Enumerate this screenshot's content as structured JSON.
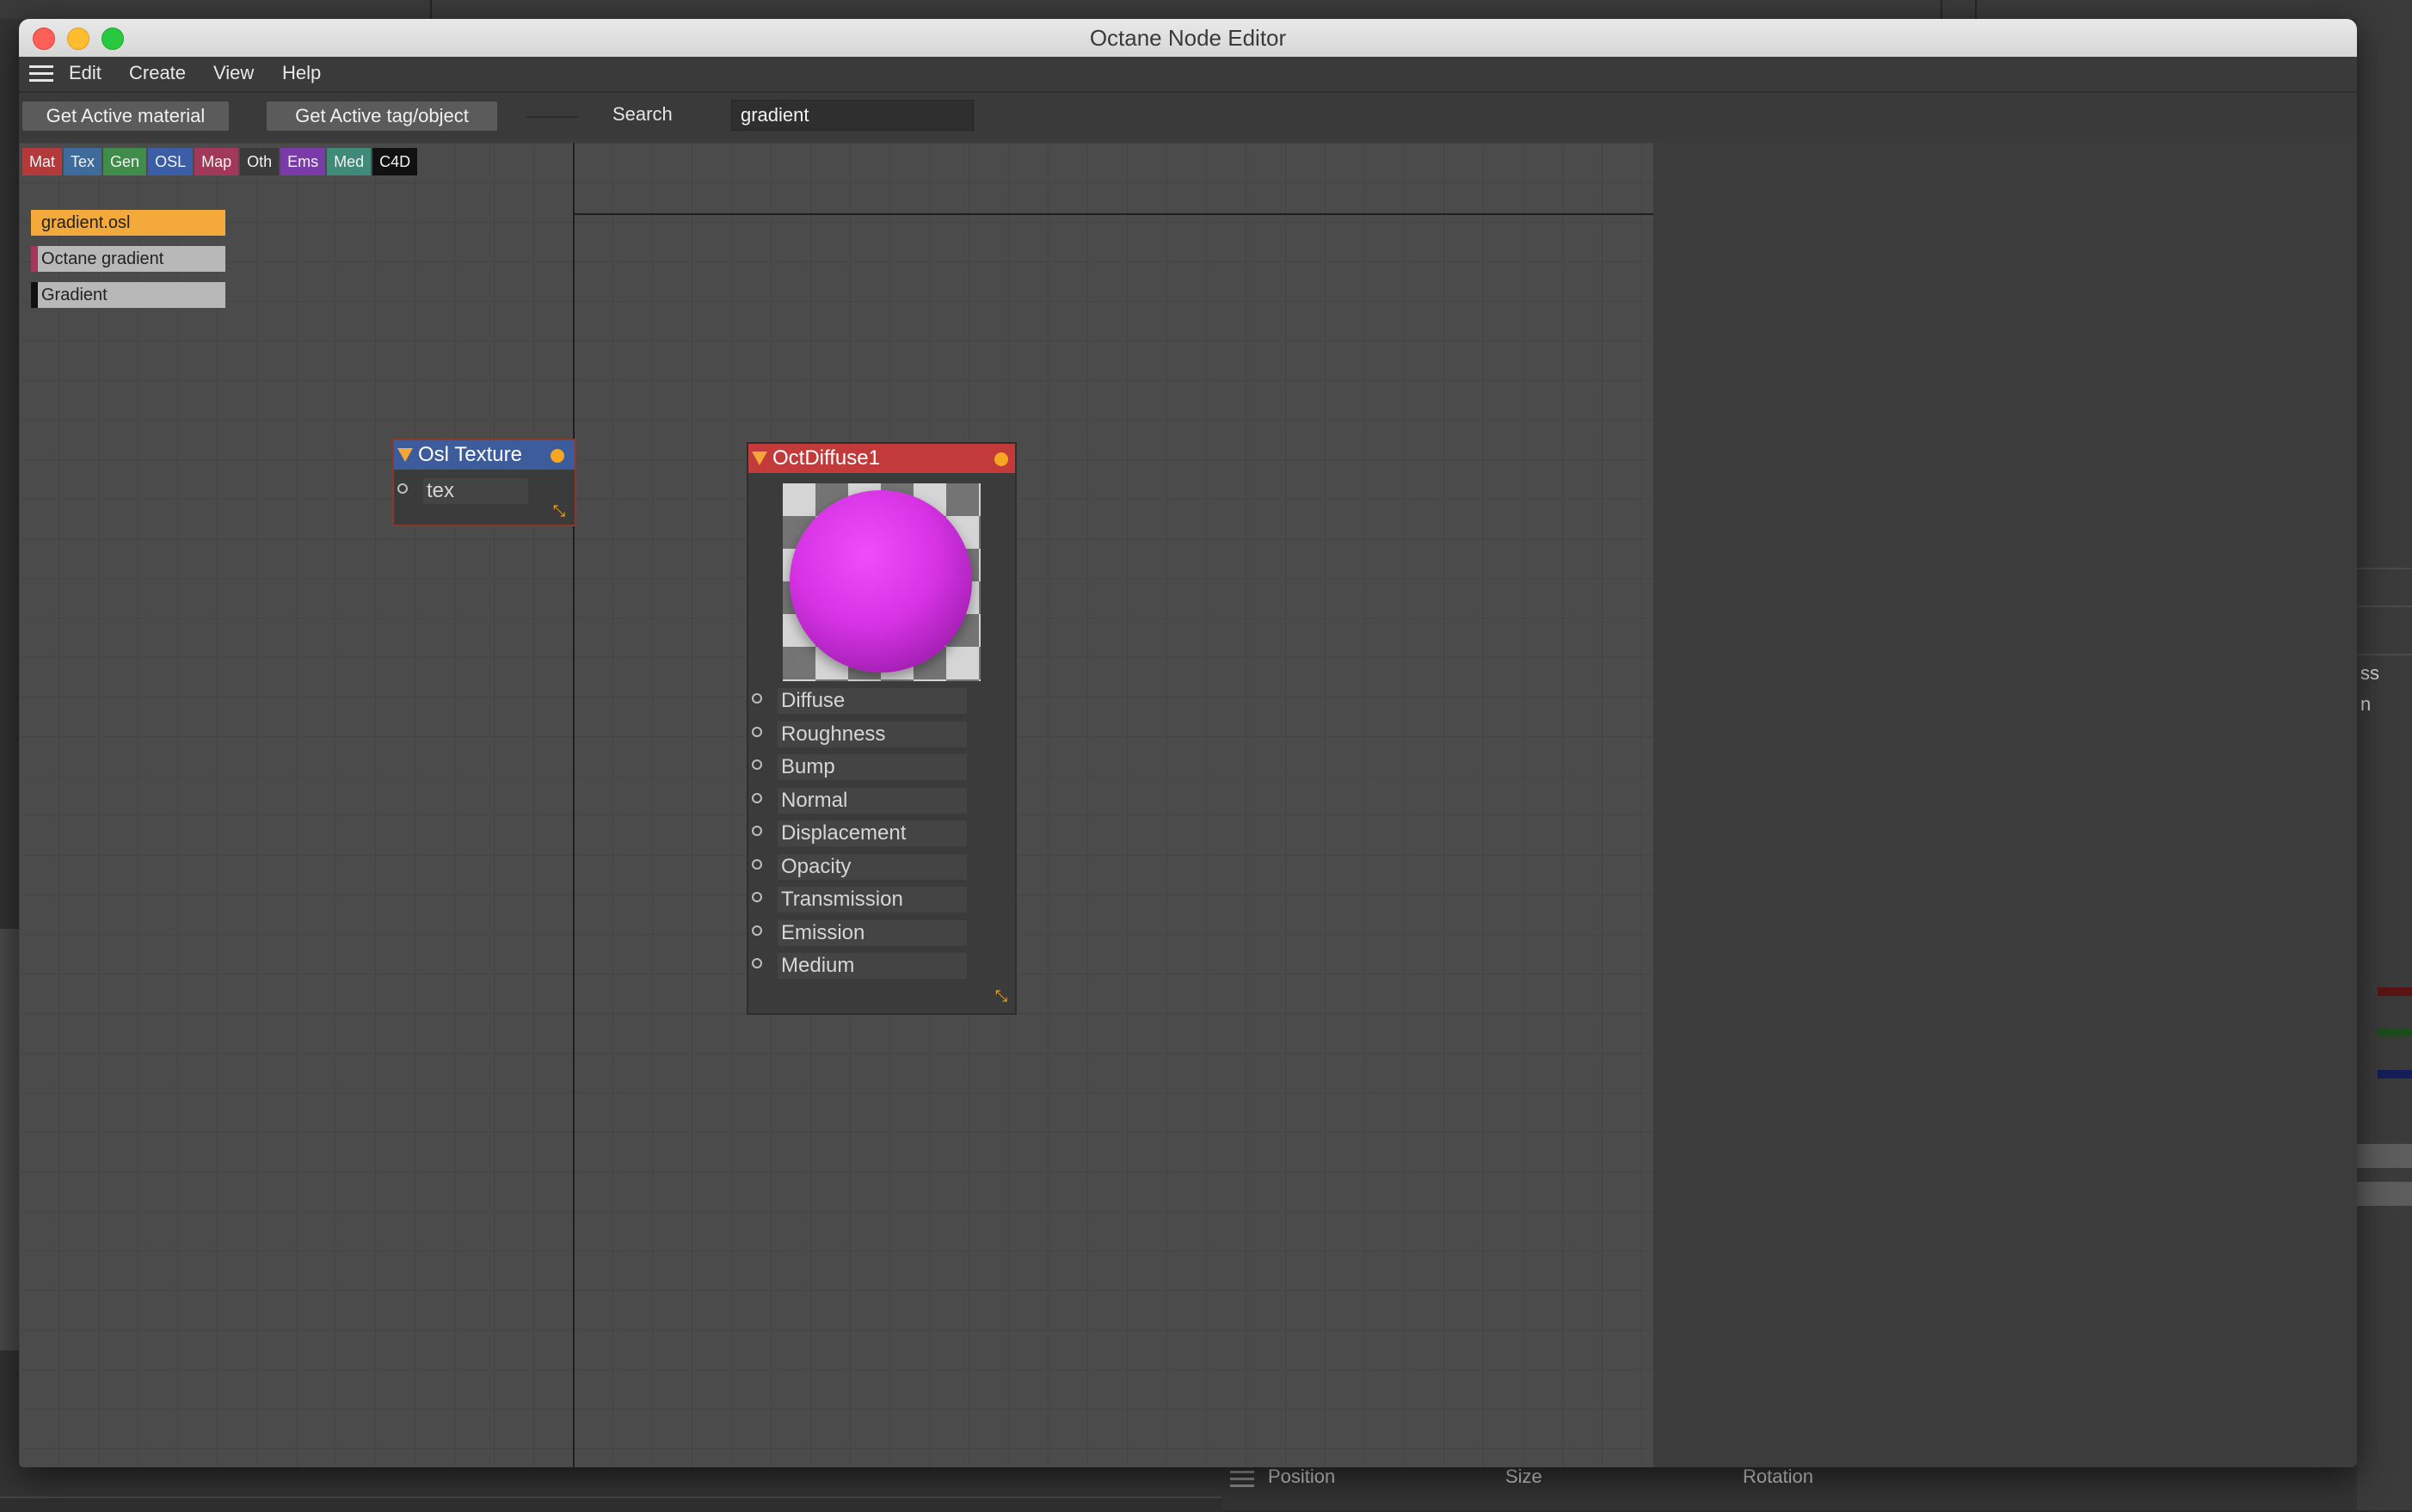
{
  "window": {
    "title": "Octane Node Editor"
  },
  "menu": [
    "Edit",
    "Create",
    "View",
    "Help"
  ],
  "toolbar": {
    "get_active_material": "Get Active material",
    "get_active_tag": "Get Active tag/object",
    "search_label": "Search",
    "search_value": "gradient"
  },
  "categories": [
    {
      "label": "Mat",
      "color": "#b23a3a"
    },
    {
      "label": "Tex",
      "color": "#3f6a9c"
    },
    {
      "label": "Gen",
      "color": "#3f8c4b"
    },
    {
      "label": "OSL",
      "color": "#3c5ea6"
    },
    {
      "label": "Map",
      "color": "#a13a5a"
    },
    {
      "label": "Oth",
      "color": "#3a3a3a"
    },
    {
      "label": "Ems",
      "color": "#7a3aa8"
    },
    {
      "label": "Med",
      "color": "#3f8a78"
    },
    {
      "label": "C4D",
      "color": "#111111"
    }
  ],
  "results": [
    {
      "label": "gradient.osl",
      "bg": "#f4a93b",
      "mark": "#f4a93b",
      "color": "#222222"
    },
    {
      "label": "Octane gradient",
      "bg": "#b8b8b8",
      "mark": "#a3385c",
      "color": "#222222"
    },
    {
      "label": "Gradient",
      "bg": "#b8b8b8",
      "mark": "#111111",
      "color": "#222222"
    }
  ],
  "nodes": {
    "osl": {
      "title": "Osl Texture",
      "header_color": "#3d5c9c",
      "ports": [
        "tex"
      ]
    },
    "diffuse": {
      "title": "OctDiffuse1",
      "header_color": "#c23a3a",
      "ports": [
        "Diffuse",
        "Roughness",
        "Bump",
        "Normal",
        "Displacement",
        "Opacity",
        "Transmission",
        "Emission",
        "Medium"
      ]
    }
  },
  "background": {
    "right_labels": [
      "ss",
      "n"
    ],
    "bottom_labels": [
      "Position",
      "Size",
      "Rotation"
    ]
  }
}
